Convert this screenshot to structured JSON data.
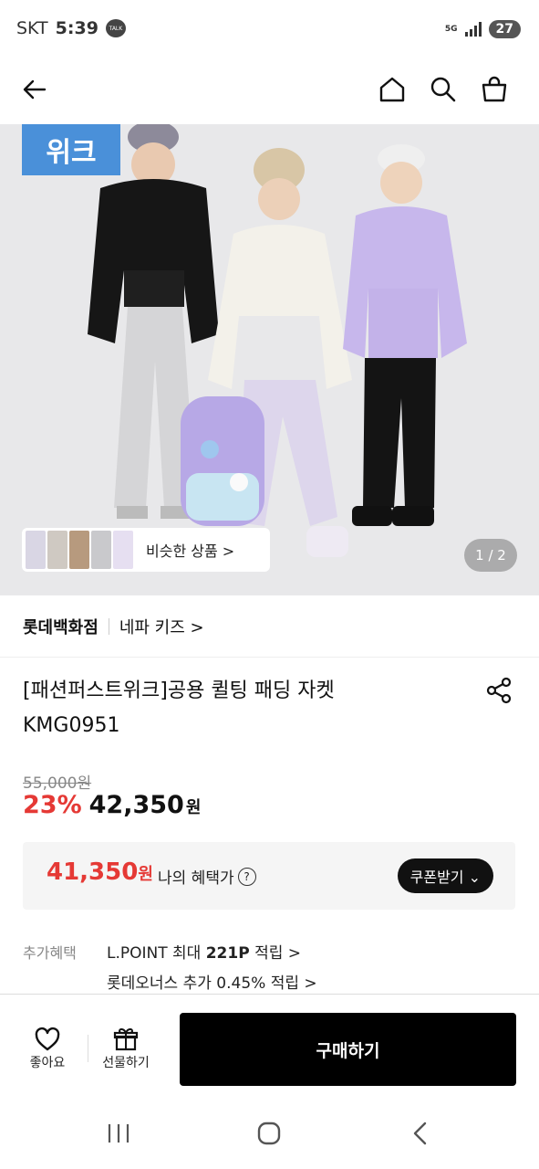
{
  "status_bar": {
    "carrier": "SKT",
    "time": "5:39",
    "talk_icon_text": "TALK",
    "network": "5G",
    "battery": "27"
  },
  "header": {
    "back_icon": "arrow-left-icon",
    "home_icon": "home-icon",
    "search_icon": "search-icon",
    "cart_icon": "shopping-bag-icon"
  },
  "hero": {
    "badge": "위크",
    "similar_label": "비슷한 상품 >",
    "page_counter": "1 / 2"
  },
  "brand": {
    "store": "롯데백화점",
    "brand_link": "네파 키즈 >"
  },
  "product": {
    "title_line1": "[패션퍼스트위크]공용 퀼팅 패딩 자켓",
    "title_line2": "KMG0951",
    "original_price": "55,000원",
    "discount": "23%",
    "sale_price": "42,350",
    "sale_won": "원"
  },
  "benefit": {
    "price": "41,350",
    "won": "원",
    "label": "나의 혜택가",
    "coupon_button": "쿠폰받기 ⌄"
  },
  "extra": {
    "label": "추가혜택",
    "line1_prefix": "L.POINT 최대 ",
    "line1_bold": "221P",
    "line1_suffix": " 적립 >",
    "line2": "롯데오너스 추가 0.45% 적립 >"
  },
  "bottom_bar": {
    "like_label": "좋아요",
    "gift_label": "선물하기",
    "buy_label": "구매하기"
  },
  "colors": {
    "accent_red": "#e53935",
    "badge_blue": "#4a90d9",
    "buy_black": "#000000"
  }
}
